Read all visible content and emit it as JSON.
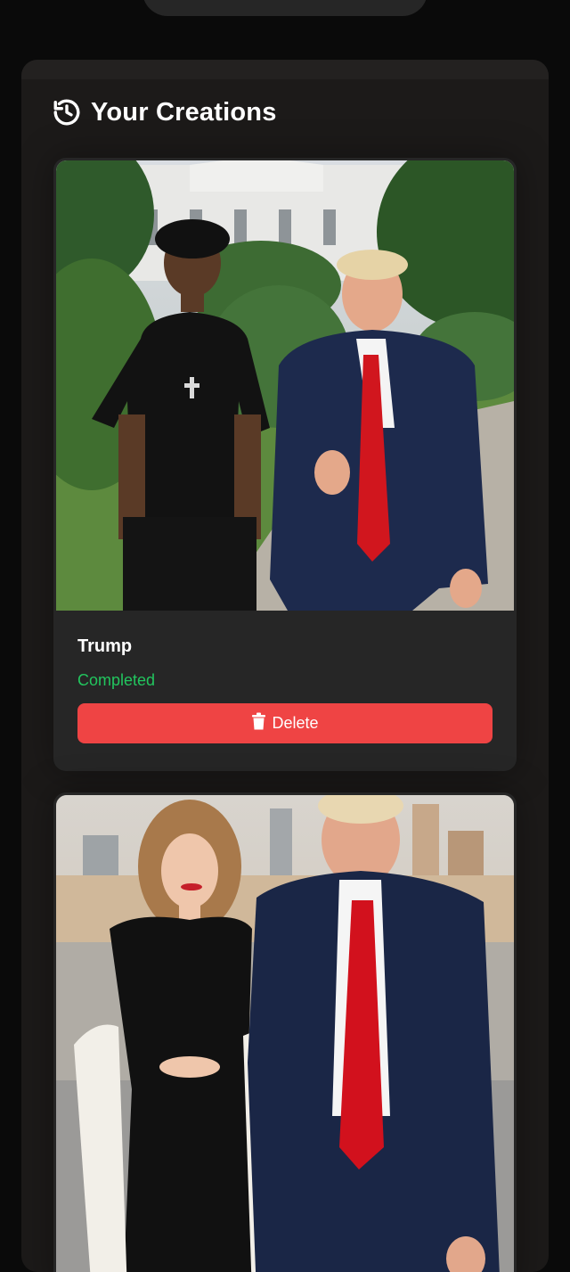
{
  "header": {
    "title": "Your Creations",
    "icon": "history-icon"
  },
  "creations": [
    {
      "title": "Trump",
      "status": "Completed",
      "status_color": "#22c55e",
      "delete_label": "Delete",
      "delete_icon": "trash-icon"
    },
    {
      "title": "",
      "status": "",
      "delete_label": ""
    }
  ],
  "colors": {
    "page_bg": "#0a0a0a",
    "panel_bg": "#1c1a19",
    "card_bg": "#262626",
    "delete_button": "#ef4444"
  }
}
